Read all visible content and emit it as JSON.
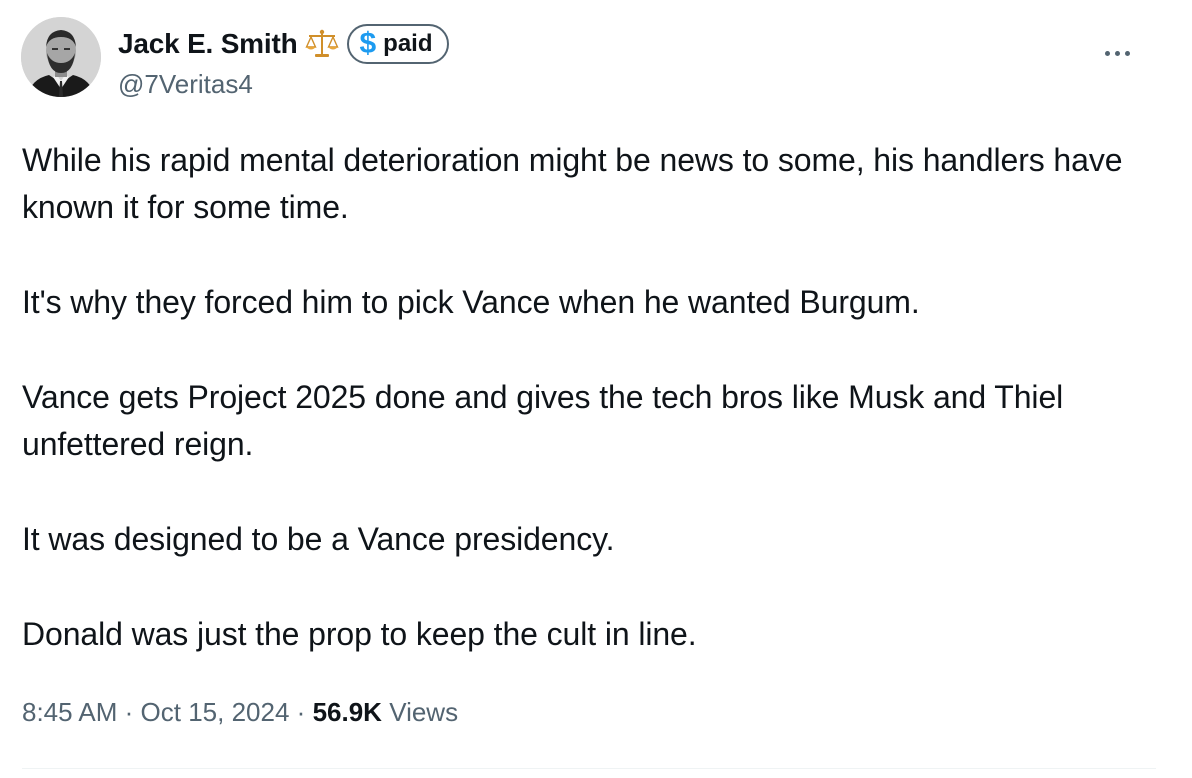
{
  "author": {
    "display_name": "Jack E. Smith",
    "handle": "@7Veritas4",
    "emoji_icon": "balance-scale-icon",
    "badge": {
      "symbol": "$",
      "label": "paid",
      "symbol_color": "#1d9bf0"
    }
  },
  "tweet": {
    "paragraphs": [
      "While his rapid mental deterioration might be news to some, his handlers have known it for some time.",
      "It's why they forced him to pick Vance when he wanted Burgum.",
      "Vance gets Project 2025 done and gives the tech bros like Musk and Thiel unfettered reign.",
      "It was designed to be a Vance presidency.",
      "Donald was just the prop to keep the cult in line."
    ]
  },
  "meta": {
    "time": "8:45 AM",
    "separator": "·",
    "date": "Oct 15, 2024",
    "views_count": "56.9K",
    "views_label": "Views"
  },
  "colors": {
    "text_primary": "#0f1419",
    "text_secondary": "#536471",
    "accent": "#1d9bf0"
  }
}
